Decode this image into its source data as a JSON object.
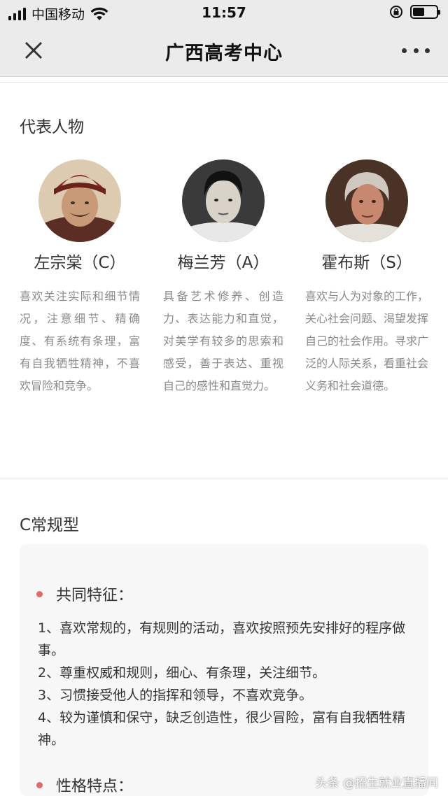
{
  "status_bar": {
    "carrier": "中国移动",
    "time": "11:57",
    "battery_level": 0.5
  },
  "nav": {
    "title": "广西高考中心",
    "close_icon": "close-icon",
    "more_icon": "more-icon"
  },
  "people_section": {
    "title": "代表人物",
    "people": [
      {
        "name": "左宗棠（C）",
        "desc": "喜欢关注实际和细节情况，注意细节、精确度、有系统有条理，富有自我牺牲精神，不喜欢冒险和竞争。"
      },
      {
        "name": "梅兰芳（A）",
        "desc": "具备艺术修养、创造力、表达能力和直觉，对美学有较多的思索和感受，善于表达、重视自己的感性和直觉力。"
      },
      {
        "name": "霍布斯（S）",
        "desc": "喜欢与人为对象的工作，关心社会问题、渴望发挥自己的社会作用。寻求广泛的人际关系，看重社会义务和社会道德。"
      }
    ]
  },
  "c_section": {
    "title": "C常规型",
    "head1": "共同特征：",
    "items": [
      "1、喜欢常规的，有规则的活动，喜欢按照预先安排好的程序做事。",
      "2、尊重权威和规则，细心、有条理，关注细节。",
      "3、习惯接受他人的指挥和领导，不喜欢竞争。",
      "4、较为谨慎和保守，缺乏创造性，很少冒险，富有自我牺牲精神。"
    ],
    "head2": "性格特点："
  },
  "watermark": "头条 @招生就业直播间",
  "colors": {
    "bar_bg": "#ebebeb",
    "bullet": "#e06a6a",
    "card_bg": "#f7f7f7"
  }
}
